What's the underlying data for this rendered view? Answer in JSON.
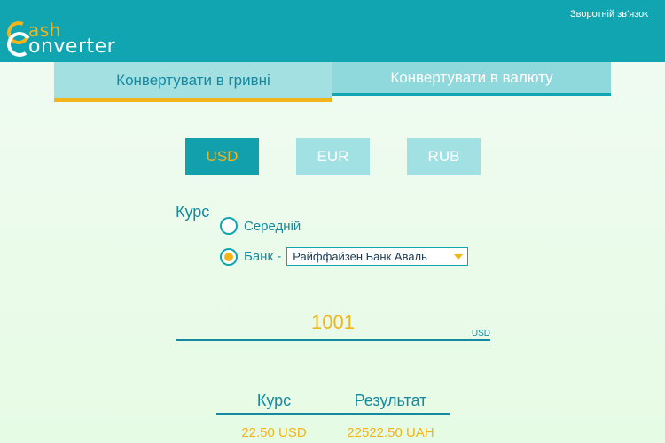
{
  "logo": {
    "line1": "ash",
    "line2": "onverter"
  },
  "header": {
    "feedback_link": "Зворотній зв'язок"
  },
  "tabs": [
    {
      "label": "Конвертувати в гривні"
    },
    {
      "label": "Конвертувати в валюту"
    }
  ],
  "currencies": [
    {
      "label": "USD",
      "selected": true
    },
    {
      "label": "EUR",
      "selected": false
    },
    {
      "label": "RUB",
      "selected": false
    }
  ],
  "rate": {
    "label": "Курс",
    "option_average": "Середній",
    "option_bank": "Банк -",
    "bank_selected": "Райффайзен Банк Аваль"
  },
  "amount": {
    "value": "1001",
    "unit": "USD"
  },
  "results": {
    "headers": [
      "Курс",
      "Результат"
    ],
    "rows": [
      [
        "22.50 USD",
        "22522.50 UAH"
      ]
    ]
  },
  "colors": {
    "accent": "#f2b41b",
    "primary": "#10a5b1"
  }
}
